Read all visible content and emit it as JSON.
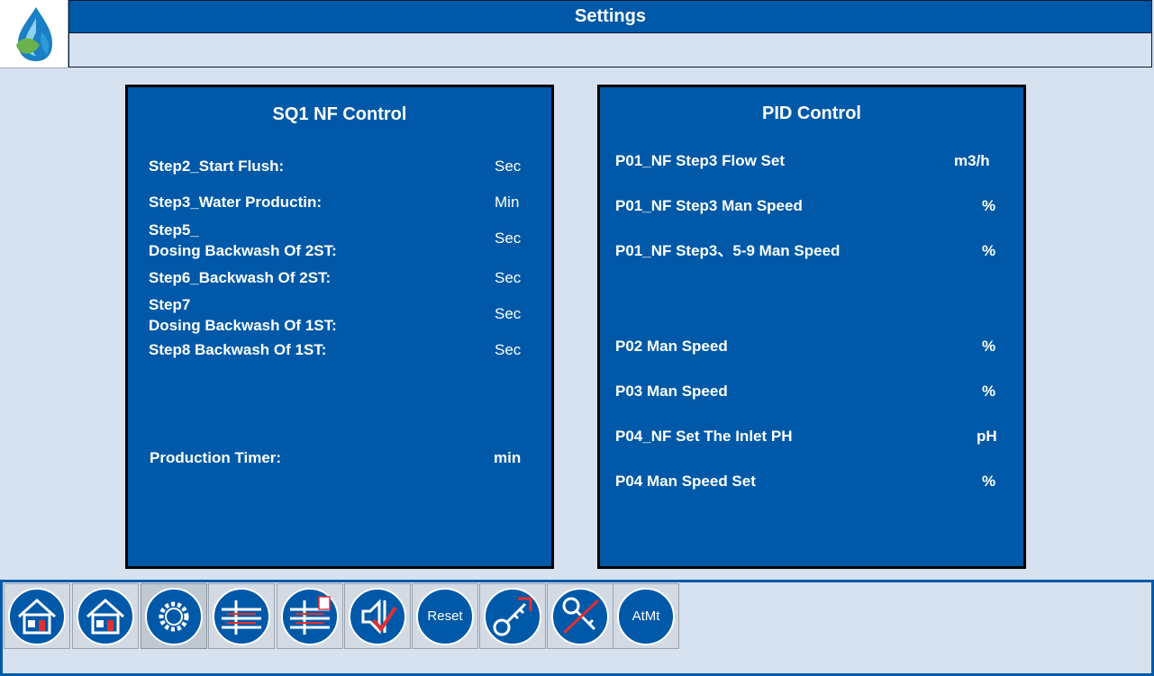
{
  "header": {
    "title": "Settings"
  },
  "left_panel": {
    "title": "SQ1 NF Control",
    "rows": [
      {
        "label_line1": "Step2_Start Flush:",
        "label_line2": "",
        "unit": "Sec"
      },
      {
        "label_line1": "Step3_Water Productin:",
        "label_line2": "",
        "unit": "Min"
      },
      {
        "label_line1": "Step5_",
        "label_line2": "Dosing Backwash Of 2ST:",
        "unit": "Sec"
      },
      {
        "label_line1": "Step6_Backwash Of 2ST:",
        "label_line2": "",
        "unit": "Sec"
      },
      {
        "label_line1": "Step7",
        "label_line2": "Dosing Backwash Of 1ST:",
        "unit": "Sec"
      },
      {
        "label_line1": "Step8 Backwash Of 1ST:",
        "label_line2": "",
        "unit": "Sec"
      }
    ],
    "timer": {
      "label": "Production Timer:",
      "unit": "min"
    }
  },
  "right_panel": {
    "title": "PID Control",
    "rows": [
      {
        "label": "P01_NF Step3 Flow Set",
        "unit": "m3/h"
      },
      {
        "label": "P01_NF Step3 Man Speed",
        "unit": "%"
      },
      {
        "label": "P01_NF Step3、5-9 Man Speed",
        "unit": "%"
      },
      {
        "label": "P02 Man Speed",
        "unit": "%"
      },
      {
        "label": "P03 Man Speed",
        "unit": "%"
      },
      {
        "label": "P04_NF Set The Inlet PH",
        "unit": "pH"
      },
      {
        "label": "P04 Man Speed Set",
        "unit": "%"
      }
    ]
  },
  "toolbar": {
    "buttons": [
      {
        "icon": "home-icon"
      },
      {
        "icon": "home-icon"
      },
      {
        "icon": "gear-icon",
        "active": true
      },
      {
        "icon": "pipes-icon"
      },
      {
        "icon": "pipes-doc-icon"
      },
      {
        "icon": "speaker-check-icon"
      },
      {
        "icon": "reset",
        "label": "Reset"
      },
      {
        "icon": "key-icon"
      },
      {
        "icon": "key-off-icon"
      },
      {
        "icon": "atmt",
        "label": "AtMt"
      }
    ]
  },
  "colors": {
    "panel": "#0059a8",
    "background": "#d6e2f0",
    "accent_red": "#e03030"
  }
}
